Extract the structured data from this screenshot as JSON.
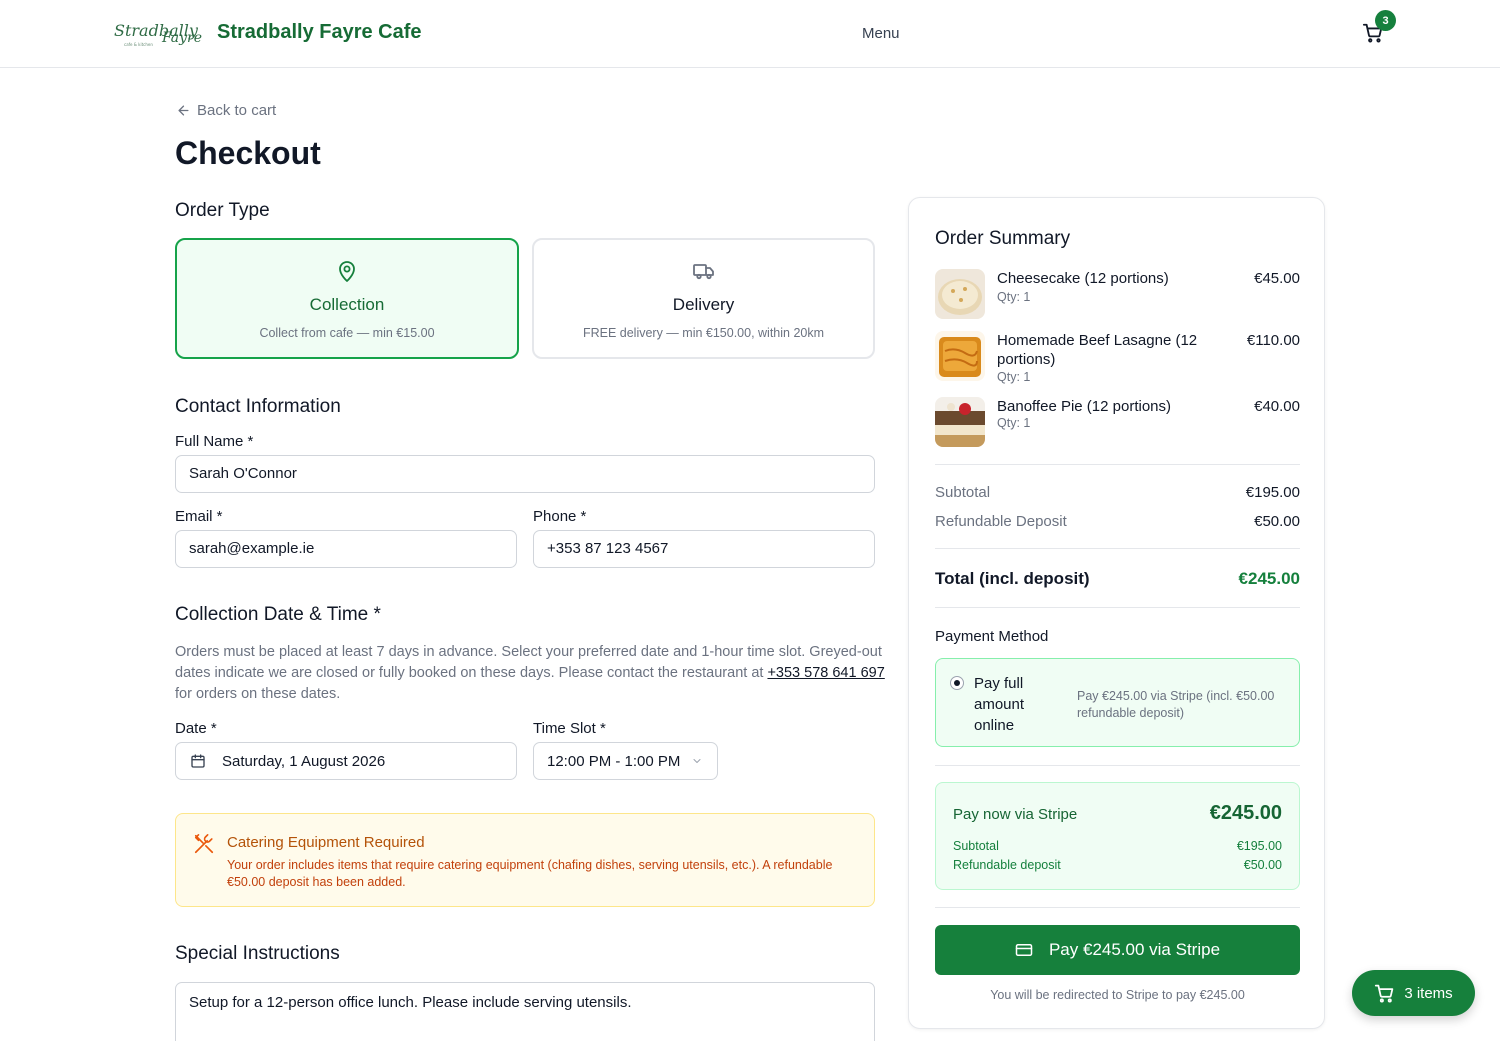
{
  "header": {
    "logo_text": "Stradbally Fayre",
    "brand": "Stradbally Fayre Cafe",
    "nav_menu": "Menu",
    "cart_count": "3"
  },
  "back_link": "Back to cart",
  "page_title": "Checkout",
  "order_type": {
    "title": "Order Type",
    "options": [
      {
        "title": "Collection",
        "subtitle": "Collect from cafe — min €15.00",
        "selected": true
      },
      {
        "title": "Delivery",
        "subtitle": "FREE delivery — min €150.00, within 20km",
        "selected": false
      }
    ]
  },
  "contact": {
    "title": "Contact Information",
    "full_name_label": "Full Name *",
    "full_name_value": "Sarah O'Connor",
    "email_label": "Email *",
    "email_value": "sarah@example.ie",
    "phone_label": "Phone *",
    "phone_value": "+353 87 123 4567"
  },
  "collection": {
    "title": "Collection Date & Time *",
    "help_before": "Orders must be placed at least 7 days in advance. Select your preferred date and 1-hour time slot. Greyed-out dates indicate we are closed or fully booked on these days. Please contact the restaurant at ",
    "help_phone": "+353 578 641 697",
    "help_after": " for orders on these dates.",
    "date_label": "Date *",
    "date_value": "Saturday, 1 August 2026",
    "time_label": "Time Slot *",
    "time_value": "12:00 PM - 1:00 PM"
  },
  "alert": {
    "title": "Catering Equipment Required",
    "text": "Your order includes items that require catering equipment (chafing dishes, serving utensils, etc.). A refundable €50.00 deposit has been added."
  },
  "special": {
    "title": "Special Instructions",
    "value": "Setup for a 12-person office lunch. Please include serving utensils."
  },
  "summary": {
    "title": "Order Summary",
    "items": [
      {
        "name": "Cheesecake (12 portions)",
        "qty": "Qty: 1",
        "price": "€45.00"
      },
      {
        "name": "Homemade Beef Lasagne (12 portions)",
        "qty": "Qty: 1",
        "price": "€110.00"
      },
      {
        "name": "Banoffee Pie (12 portions)",
        "qty": "Qty: 1",
        "price": "€40.00"
      }
    ],
    "subtotal_label": "Subtotal",
    "subtotal_value": "€195.00",
    "deposit_label": "Refundable Deposit",
    "deposit_value": "€50.00",
    "total_label": "Total (incl. deposit)",
    "total_value": "€245.00",
    "payment_method_label": "Payment Method",
    "payment_option_title": "Pay full amount online",
    "payment_option_desc": "Pay €245.00 via Stripe (incl. €50.00 refundable deposit)",
    "stripe_title": "Pay now via Stripe",
    "stripe_amount": "€245.00",
    "stripe_subtotal_label": "Subtotal",
    "stripe_subtotal_value": "€195.00",
    "stripe_deposit_label": "Refundable deposit",
    "stripe_deposit_value": "€50.00",
    "pay_button": "Pay €245.00 via Stripe",
    "redirect_note": "You will be redirected to Stripe to pay €245.00"
  },
  "fab_label": "3 items",
  "colors": {
    "brand_green": "#166b35",
    "accent_green": "#16803c",
    "alert_amber": "#b45309"
  }
}
